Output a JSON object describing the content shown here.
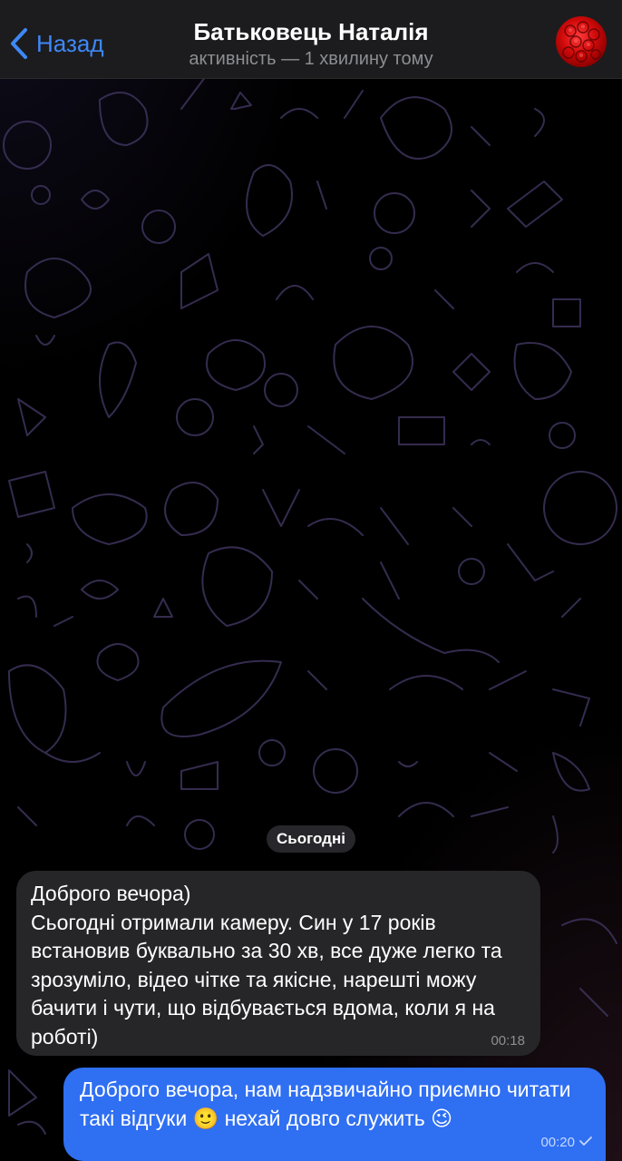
{
  "header": {
    "back_label": "Назад",
    "contact_name": "Батьковець Наталія",
    "status": "активність — 1 хвилину тому",
    "avatar_icon": "roses-avatar"
  },
  "chat": {
    "date_separator": "Сьогодні",
    "messages": [
      {
        "direction": "incoming",
        "text": "Доброго вечора)\nСьогодні отримали камеру. Син у 17 років встановив буквально за 30 хв, все дуже легко та зрозуміло, відео чітке та якісне, нарешті можу бачити і чути, що відбувається вдома, коли я на роботі)",
        "time": "00:18"
      },
      {
        "direction": "outgoing",
        "text": "Доброго вечора, нам надзвичайно приємно читати такі відгуки 🙂 нехай довго служить 😉",
        "time": "00:20",
        "status_icon": "sent-check-icon"
      }
    ]
  },
  "colors": {
    "accent": "#3e88f7",
    "header_bg": "#1c1c1e",
    "incoming_bubble": "#262628",
    "outgoing_bubble": "#2f6ff2",
    "background": "#000000"
  }
}
